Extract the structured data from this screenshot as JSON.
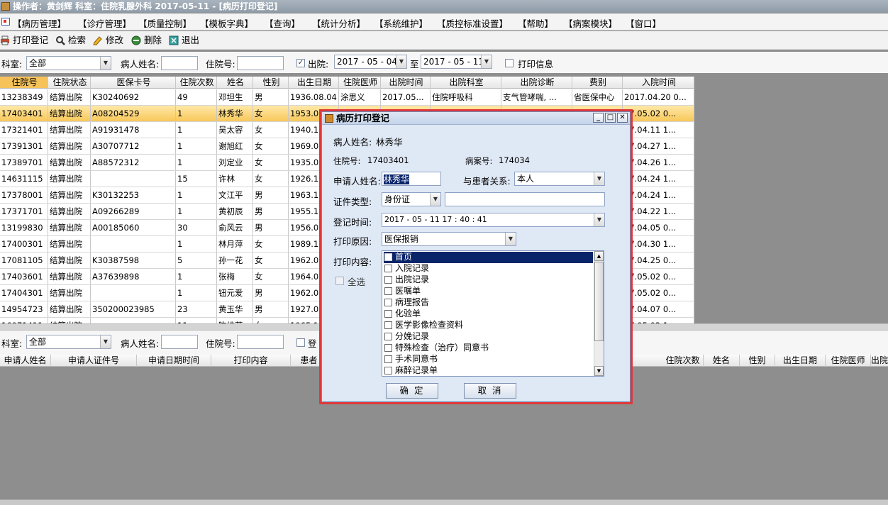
{
  "titlebar": {
    "text": "操作者：黄剑辉   科室：住院乳腺外科   2017-05-11 - [病历打印登记]"
  },
  "menu": [
    "【病历管理】",
    "【诊疗管理】",
    "【质量控制】",
    "【模板字典】",
    "【查询】",
    "【统计分析】",
    "【系统维护】",
    "【质控标准设置】",
    "【帮助】",
    "【病案模块】",
    "【窗口】"
  ],
  "toolbar": {
    "print_reg": "打印登记",
    "search": "检索",
    "edit": "修改",
    "delete": "删除",
    "exit": "退出"
  },
  "filter1": {
    "dept_label": "科室:",
    "dept_value": "全部",
    "patient_label": "病人姓名:",
    "admission_label": "住院号:",
    "discharge_label": "出院:",
    "discharge_checked": "✓",
    "date_from": "2017 - 05 - 04",
    "to_label": "至",
    "date_to": "2017 - 05 - 11",
    "print_info_label": "打印信息"
  },
  "grid1": {
    "columns": [
      "住院号",
      "住院状态",
      "医保卡号",
      "住院次数",
      "姓名",
      "性别",
      "出生日期",
      "住院医师",
      "出院时间",
      "出院科室",
      "出院诊断",
      "费别",
      "入院时间"
    ],
    "rows": [
      [
        "13238349",
        "结算出院",
        "K30240692",
        "49",
        "邓坦生",
        "男",
        "1936.08.04",
        "涂思义",
        "2017.05...",
        "住院呼吸科",
        "支气管哮喘, ...",
        "省医保中心",
        "2017.04.20 0..."
      ],
      [
        "17403401",
        "结算出院",
        "A08204529",
        "1",
        "林秀华",
        "女",
        "1953.08",
        "",
        "",
        "",
        "",
        "",
        "17.05.02 0..."
      ],
      [
        "17321401",
        "结算出院",
        "A91931478",
        "1",
        "吴太容",
        "女",
        "1940.10",
        "",
        "",
        "",
        "",
        "",
        "17.04.11 1..."
      ],
      [
        "17391301",
        "结算出院",
        "A30707712",
        "1",
        "谢旭红",
        "女",
        "1969.02",
        "",
        "",
        "",
        "",
        "",
        "17.04.27 1..."
      ],
      [
        "17389701",
        "结算出院",
        "A88572312",
        "1",
        "刘定业",
        "女",
        "1935.05",
        "",
        "",
        "",
        "",
        "",
        "17.04.26 1..."
      ],
      [
        "14631115",
        "结算出院",
        "",
        "15",
        "许林",
        "女",
        "1926.11",
        "",
        "",
        "",
        "",
        "",
        "17.04.24 1..."
      ],
      [
        "17378001",
        "结算出院",
        "K30132253",
        "1",
        "文江平",
        "男",
        "1963.10",
        "",
        "",
        "",
        "",
        "",
        "17.04.24 1..."
      ],
      [
        "17371701",
        "结算出院",
        "A09266289",
        "1",
        "黄初辰",
        "男",
        "1955.10",
        "",
        "",
        "",
        "",
        "",
        "17.04.22 1..."
      ],
      [
        "13199830",
        "结算出院",
        "A00185060",
        "30",
        "俞风云",
        "男",
        "1956.09",
        "",
        "",
        "",
        "",
        "",
        "17.04.05 0..."
      ],
      [
        "17400301",
        "结算出院",
        "",
        "1",
        "林月萍",
        "女",
        "1989.12",
        "",
        "",
        "",
        "",
        "",
        "17.04.30 1..."
      ],
      [
        "17081105",
        "结算出院",
        "K30387598",
        "5",
        "孙一花",
        "女",
        "1962.07",
        "",
        "",
        "",
        "",
        "",
        "17.04.25 0..."
      ],
      [
        "17403601",
        "结算出院",
        "A37639898",
        "1",
        "张梅",
        "女",
        "1964.07",
        "",
        "",
        "",
        "",
        "",
        "17.05.02 0..."
      ],
      [
        "17404301",
        "结算出院",
        "",
        "1",
        "钮元爱",
        "男",
        "1962.02",
        "",
        "",
        "",
        "",
        "",
        "17.05.02 0..."
      ],
      [
        "14954723",
        "结算出院",
        "350200023985",
        "23",
        "黄玉华",
        "男",
        "1927.02",
        "",
        "",
        "",
        "",
        "",
        "17.04.07 0..."
      ],
      [
        "16971411",
        "结算出院",
        "",
        "11",
        "陈维芬",
        "女",
        "1965.11",
        "",
        "",
        "",
        "",
        "",
        "17.05.02 1..."
      ]
    ]
  },
  "filter2": {
    "dept_label": "科室:",
    "dept_value": "全部",
    "patient_label": "病人姓名:",
    "admission_label": "住院号:",
    "reg_label": "登"
  },
  "grid2": {
    "columns_left": [
      "申请人姓名",
      "申请人证件号",
      "申请日期时间",
      "打印内容",
      "患者"
    ],
    "columns_right": [
      "住院次数",
      "姓名",
      "性别",
      "出生日期",
      "住院医师",
      "出院"
    ]
  },
  "dialog": {
    "title": "病历打印登记",
    "patient_name_label": "病人姓名:",
    "patient_name": "林秀华",
    "admission_label": "住院号:",
    "admission_no": "17403401",
    "case_label": "病案号:",
    "case_no": "174034",
    "applicant_label": "申请人姓名:",
    "applicant_value": "林秀华",
    "relation_label": "与患者关系:",
    "relation_value": "本人",
    "id_type_label": "证件类型:",
    "id_type_value": "身份证",
    "reg_time_label": "登记时间:",
    "reg_time_value": "2017 - 05 - 11    17 : 40 : 41",
    "print_reason_label": "打印原因:",
    "print_reason_value": "医保报销",
    "print_content_label": "打印内容:",
    "select_all_label": "全选",
    "content_items": [
      "首页",
      "入院记录",
      "出院记录",
      "医嘱单",
      "病理报告",
      "化验单",
      "医学影像检查资料",
      "分娩记录",
      "特殊检查（治疗）同意书",
      "手术同意书",
      "麻醉记录单"
    ],
    "ok_label": "确 定",
    "cancel_label": "取 消"
  }
}
